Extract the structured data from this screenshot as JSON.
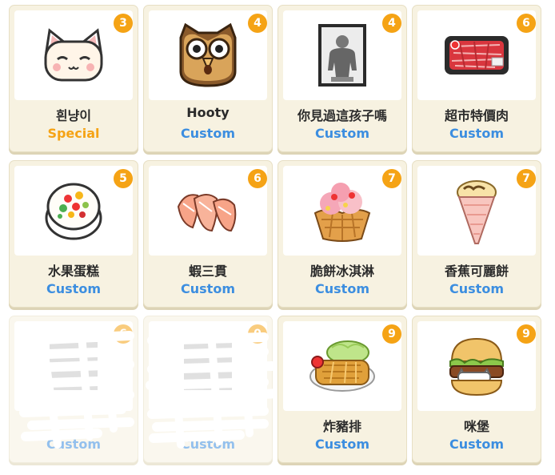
{
  "items": [
    {
      "name": "흰냥이",
      "type": "Special",
      "count": "3",
      "icon": "white-cat-icon"
    },
    {
      "name": "Hooty",
      "type": "Custom",
      "count": "4",
      "icon": "owl-icon"
    },
    {
      "name": "你見過這孩子嗎",
      "type": "Custom",
      "count": "4",
      "icon": "framed-portrait-icon"
    },
    {
      "name": "超市特價肉",
      "type": "Custom",
      "count": "6",
      "icon": "meat-tray-icon"
    },
    {
      "name": "水果蛋糕",
      "type": "Custom",
      "count": "5",
      "icon": "fruit-cake-icon"
    },
    {
      "name": "蝦三貫",
      "type": "Custom",
      "count": "6",
      "icon": "shrimp-sushi-icon"
    },
    {
      "name": "脆餅冰淇淋",
      "type": "Custom",
      "count": "7",
      "icon": "waffle-ice-cream-icon"
    },
    {
      "name": "香蕉可麗餅",
      "type": "Custom",
      "count": "7",
      "icon": "banana-crepe-icon"
    },
    {
      "name": "",
      "type": "Custom",
      "count": "6",
      "icon": "redacted-item-icon"
    },
    {
      "name": "",
      "type": "Custom",
      "count": "0",
      "icon": "redacted-item-icon"
    },
    {
      "name": "炸豬排",
      "type": "Custom",
      "count": "9",
      "icon": "pork-cutlet-icon"
    },
    {
      "name": "咪堡",
      "type": "Custom",
      "count": "9",
      "icon": "cat-burger-icon"
    }
  ],
  "colors": {
    "card_bg": "#f7f2e1",
    "badge": "#f5a315",
    "custom_text": "#3c8ee0",
    "special_text": "#f5a315"
  }
}
